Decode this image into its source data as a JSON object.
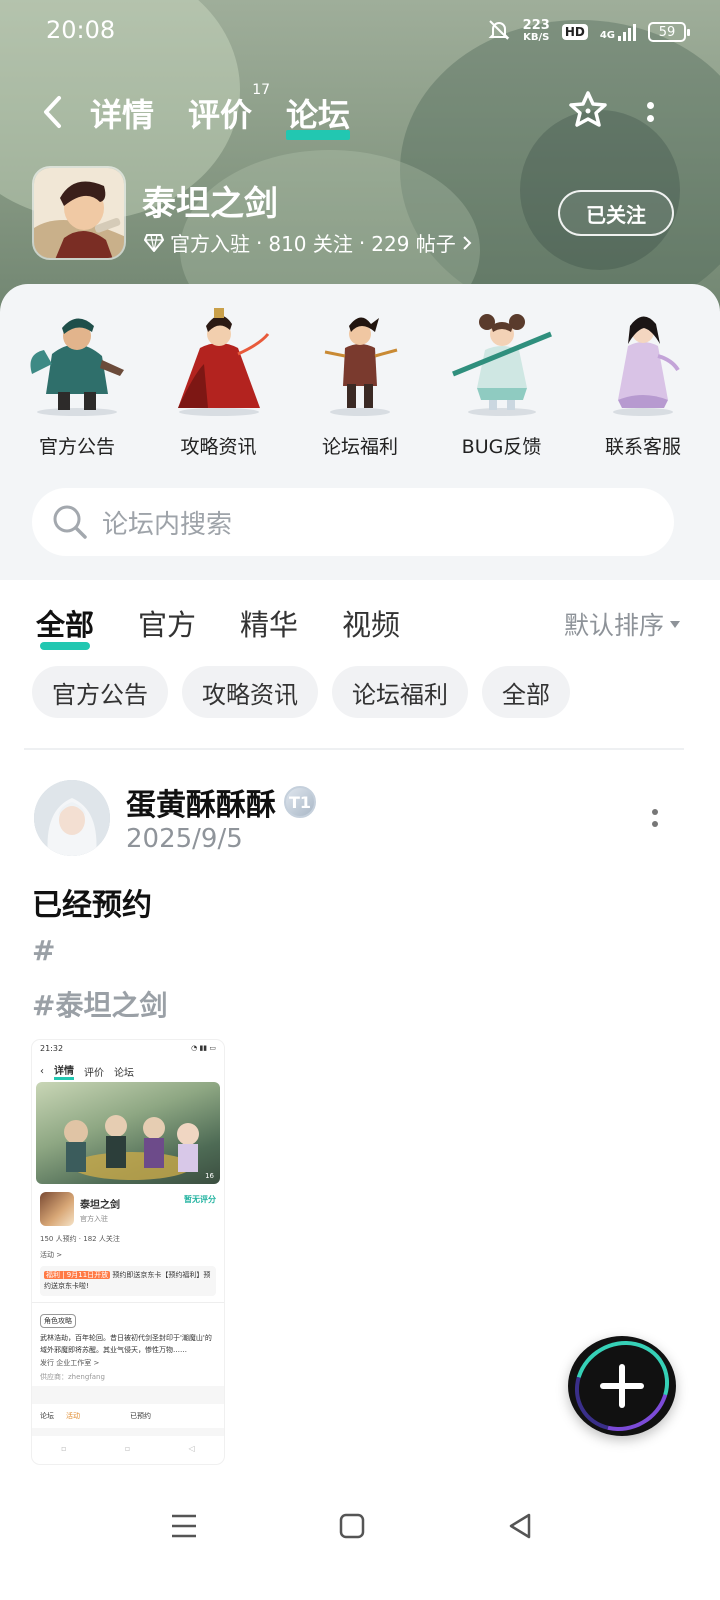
{
  "status_bar": {
    "time": "20:08",
    "net_speed_value": "223",
    "net_speed_unit": "KB/S",
    "hd_label": "HD",
    "network": "4G",
    "battery": "59"
  },
  "top_nav": {
    "tabs": [
      {
        "label": "详情",
        "active": false
      },
      {
        "label": "评价",
        "badge": "17",
        "active": false
      },
      {
        "label": "论坛",
        "active": true
      }
    ],
    "icons": [
      "back-arrow-icon",
      "star-outline-icon",
      "more-vertical-icon"
    ]
  },
  "game": {
    "title": "泰坦之剑",
    "official_label": "官方入驻",
    "sep": "·",
    "followers": "810 关注",
    "posts": "229 帖子",
    "follow_button": "已关注"
  },
  "categories": [
    {
      "label": "官方公告",
      "icon": "character-warrior-icon"
    },
    {
      "label": "攻略资讯",
      "icon": "character-red-lady-icon"
    },
    {
      "label": "论坛福利",
      "icon": "character-archer-icon"
    },
    {
      "label": "BUG反馈",
      "icon": "character-dancer-icon"
    },
    {
      "label": "联系客服",
      "icon": "character-maiden-icon"
    }
  ],
  "search": {
    "placeholder": "论坛内搜索"
  },
  "filter_tabs": [
    {
      "label": "全部",
      "active": true
    },
    {
      "label": "官方",
      "active": false
    },
    {
      "label": "精华",
      "active": false
    },
    {
      "label": "视频",
      "active": false
    }
  ],
  "sort": {
    "label": "默认排序"
  },
  "chips": [
    "官方公告",
    "攻略资讯",
    "论坛福利",
    "全部"
  ],
  "post": {
    "author": "蛋黄酥酥酥",
    "level_badge": "T1",
    "date": "2025/9/5",
    "title": "已经预约",
    "tags": [
      "#",
      "#泰坦之剑"
    ],
    "thumbnail": {
      "time": "21:32",
      "tabs": [
        "详情",
        "评价",
        "论坛"
      ],
      "banner_count": "16",
      "name": "泰坦之剑",
      "sub": "官方入驻",
      "score": "暂无评分",
      "stats": "150 人预约 · 182 人关注",
      "activity": "活动 >",
      "notice_tag": "福利 | 9月11日开放",
      "notice_text": "预约即送京东卡【预约福利】预约送京东卡啦!",
      "role": "角色攻略",
      "desc": "武林浩劫，百年轮回。昔日被初代剑圣封印于'潮魔山'的域外邪魔即将苏醒。其业气侵天，惨性万物……",
      "publisher": "发行  企业工作室 >",
      "vendor": "供应商：zhengfang",
      "bar_left": "论坛",
      "bar_mid": "活动",
      "bar_btn": "已预约"
    }
  },
  "fab": {
    "icon": "plus-icon"
  },
  "system_nav": [
    "menu-icon",
    "home-square-icon",
    "back-triangle-icon"
  ]
}
